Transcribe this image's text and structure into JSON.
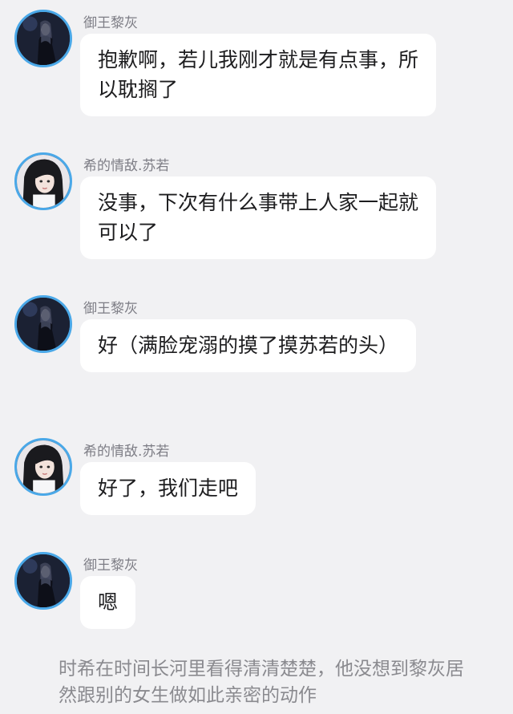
{
  "colors": {
    "background": "#f1f1f3",
    "bubble": "#ffffff",
    "avatar_ring": "#4aa8e8",
    "sender_name": "#7d7d85",
    "narration": "#8a8a8f"
  },
  "messages": [
    {
      "sender": "御王黎灰",
      "avatar": "avatar-dark-robed-figure",
      "text": "抱歉啊，若儿我刚才就是有点事，所以耽搁了"
    },
    {
      "sender": "希的情敌.苏若",
      "avatar": "avatar-girl-portrait",
      "text": "没事，下次有什么事带上人家一起就可以了"
    },
    {
      "sender": "御王黎灰",
      "avatar": "avatar-dark-robed-figure",
      "text": "好（满脸宠溺的摸了摸苏若的头）"
    },
    {
      "sender": "希的情敌.苏若",
      "avatar": "avatar-girl-portrait",
      "text": "好了，我们走吧"
    },
    {
      "sender": "御王黎灰",
      "avatar": "avatar-dark-robed-figure",
      "text": "嗯"
    }
  ],
  "narration": "时希在时间长河里看得清清楚楚，他没想到黎灰居然跟别的女生做如此亲密的动作"
}
